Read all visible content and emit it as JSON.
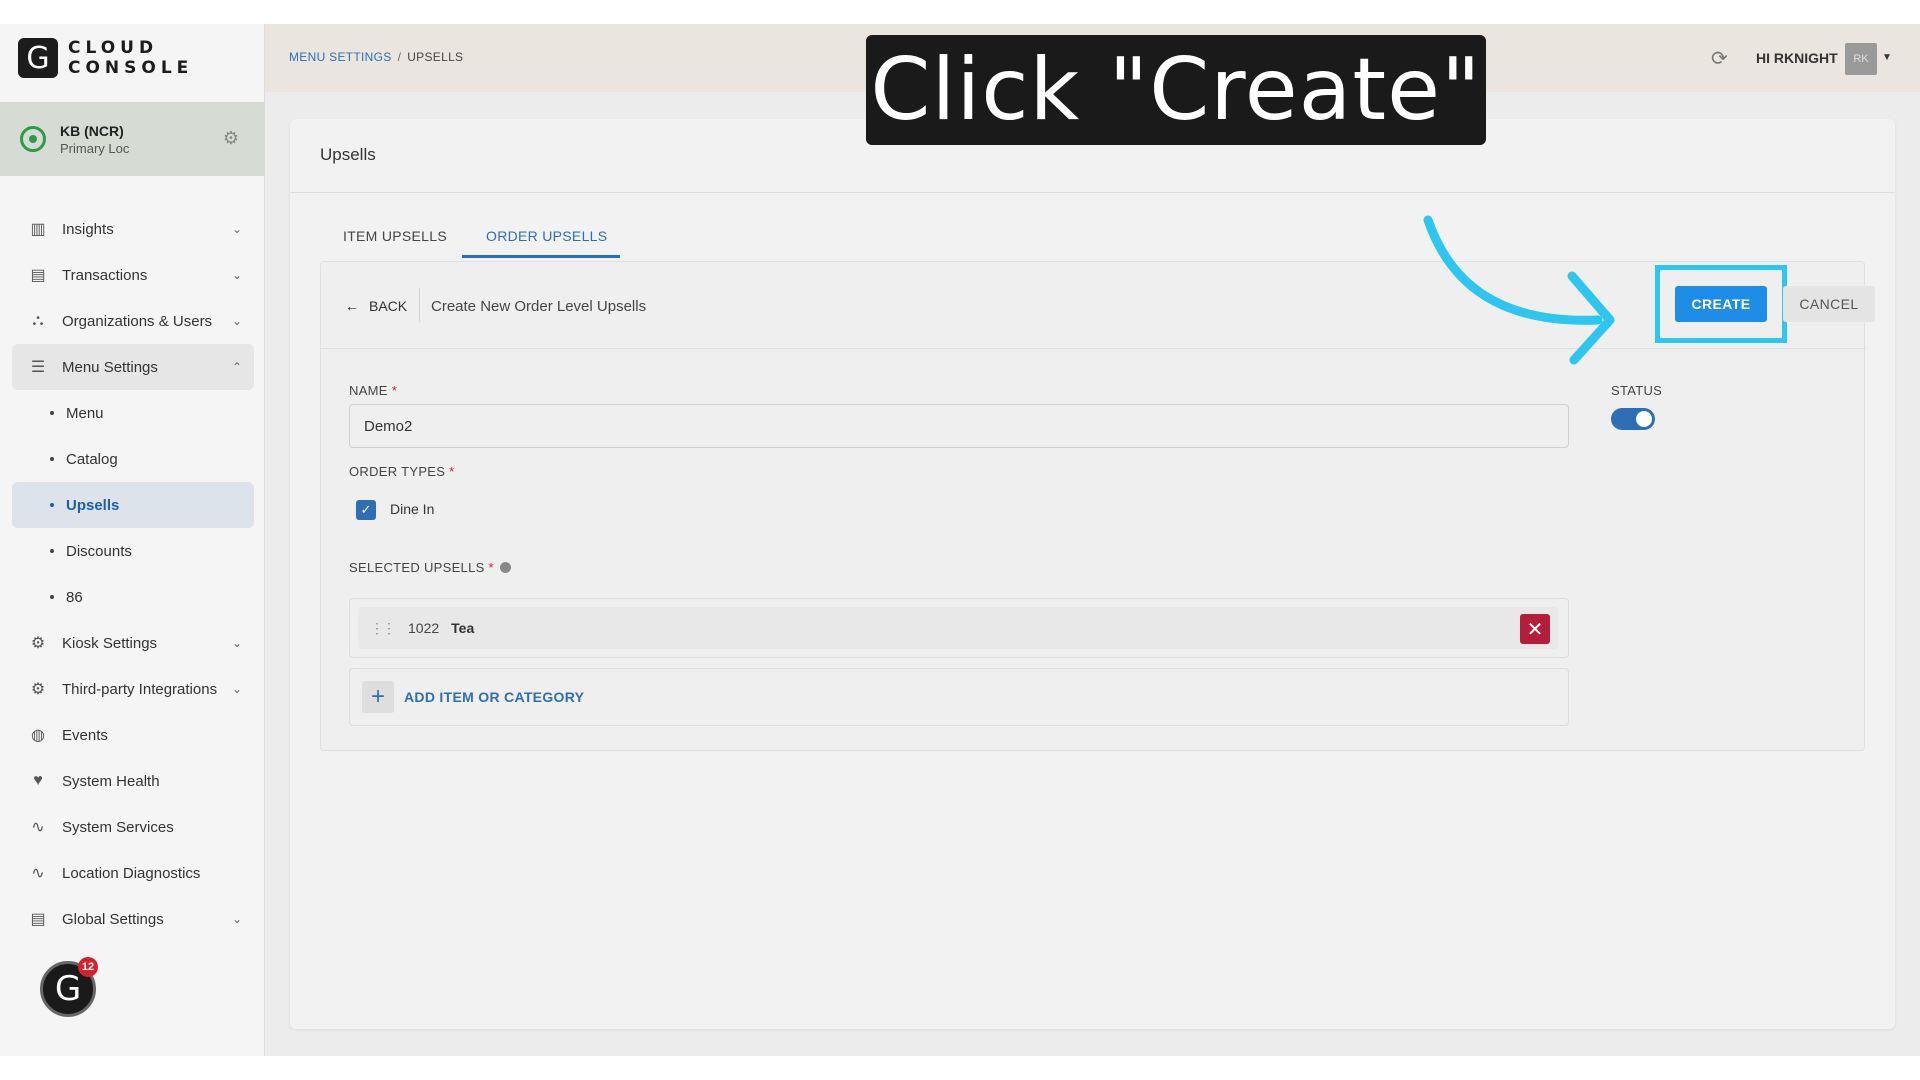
{
  "brand": {
    "mark": "G",
    "line1": "CLOUD",
    "line2": "CONSOLE"
  },
  "location": {
    "name": "KB (NCR)",
    "sub": "Primary Loc"
  },
  "nav": {
    "insights": "Insights",
    "transactions": "Transactions",
    "organizations": "Organizations & Users",
    "menu_settings": "Menu Settings",
    "menu": "Menu",
    "catalog": "Catalog",
    "upsells": "Upsells",
    "discounts": "Discounts",
    "eighty_six": "86",
    "kiosk": "Kiosk Settings",
    "third_party": "Third-party Integrations",
    "events": "Events",
    "system_health": "System Health",
    "system_services": "System Services",
    "location_diagnostics": "Location Diagnostics",
    "global_settings": "Global Settings"
  },
  "chat": {
    "mark": "G",
    "count": "12"
  },
  "header": {
    "crumb_link": "MENU SETTINGS",
    "crumb_sep": "/",
    "crumb_current": "UPSELLS",
    "user": "HI RKNIGHT",
    "avatar": "RK"
  },
  "page": {
    "title": "Upsells",
    "tab_item": "ITEM UPSELLS",
    "tab_order": "ORDER UPSELLS"
  },
  "form": {
    "back": "BACK",
    "title": "Create New Order Level Upsells",
    "create": "CREATE",
    "cancel": "CANCEL",
    "name_label": "NAME",
    "name_value": "Demo2",
    "status_label": "STATUS",
    "status_on": true,
    "order_types_label": "ORDER TYPES",
    "dine_in": "Dine In",
    "dine_in_checked": true,
    "selected_label": "SELECTED UPSELLS",
    "upsell_code": "1022",
    "upsell_name": "Tea",
    "add_label": "ADD ITEM OR CATEGORY",
    "required": "*"
  },
  "overlay": {
    "caption": "Click \"Create\""
  },
  "colors": {
    "accent": "#2f6eb5",
    "create": "#1e8de8",
    "highlight": "#2cc6ee",
    "danger": "#b51e3a"
  }
}
